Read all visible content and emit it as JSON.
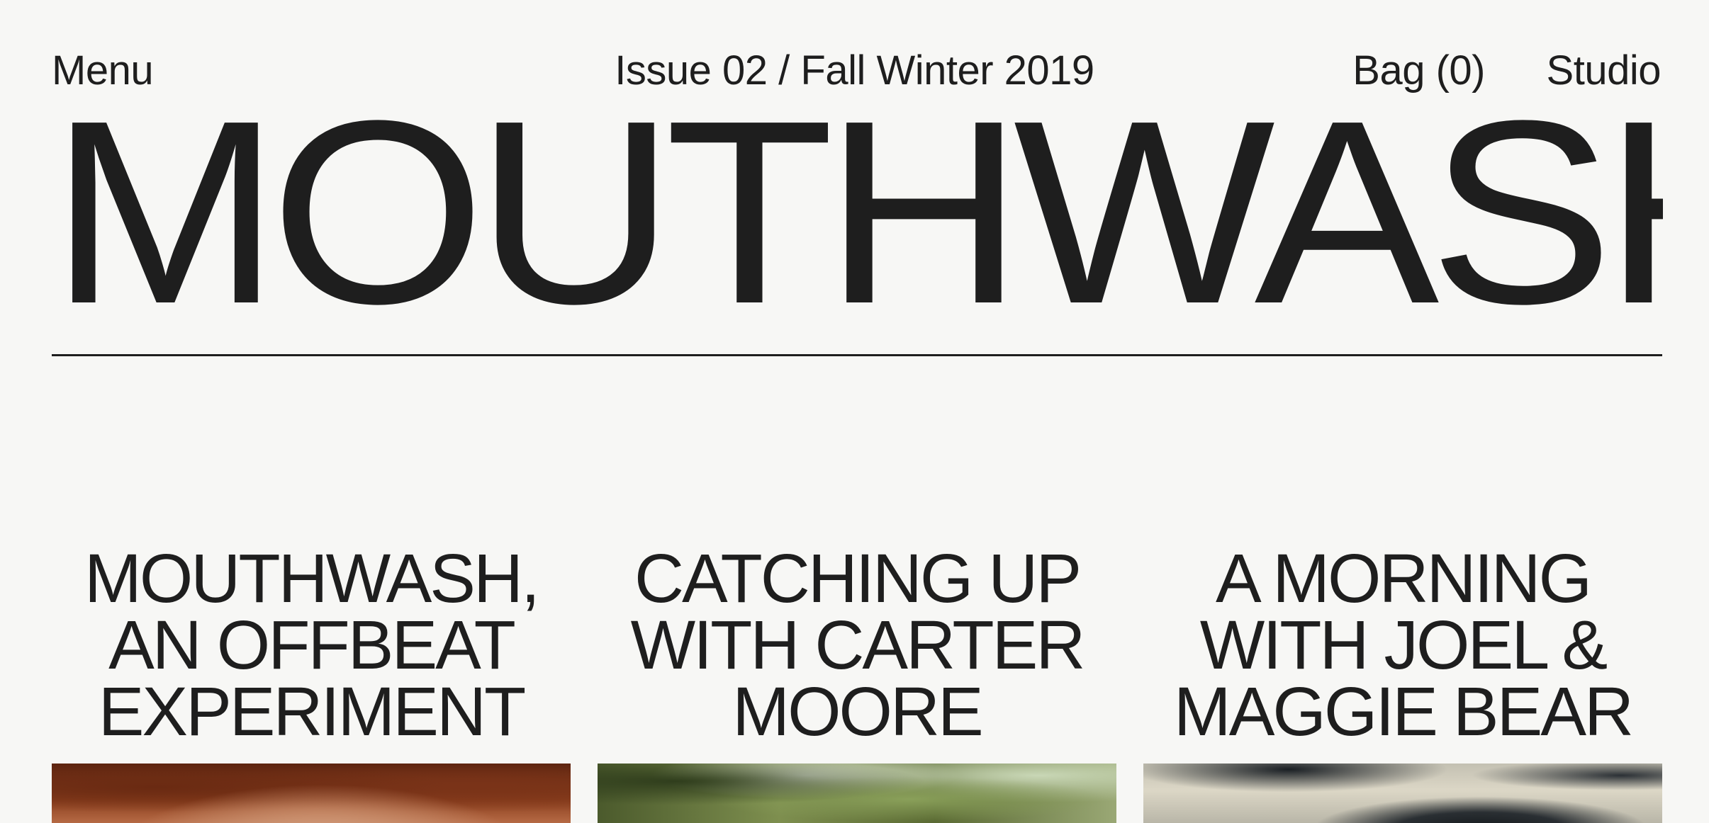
{
  "header": {
    "menu_label": "Menu",
    "issue_label": "Issue 02 / Fall Winter 2019",
    "bag_label": "Bag (0)",
    "studio_label": "Studio"
  },
  "masthead": {
    "title": "MOUTHWASH"
  },
  "articles": [
    {
      "title_lines": [
        "MOUTHWASH,",
        "AN OFFBEAT",
        "EXPERIMENT"
      ],
      "image": "portrait-photo"
    },
    {
      "title_lines": [
        "CATCHING UP",
        "WITH CARTER",
        "MOORE"
      ],
      "image": "trees-photo"
    },
    {
      "title_lines": [
        "A MORNING",
        "WITH JOEL &",
        "MAGGIE BEAR"
      ],
      "image": "blurred-photo"
    }
  ],
  "colors": {
    "background": "#f7f7f5",
    "text": "#1e1e1e"
  }
}
